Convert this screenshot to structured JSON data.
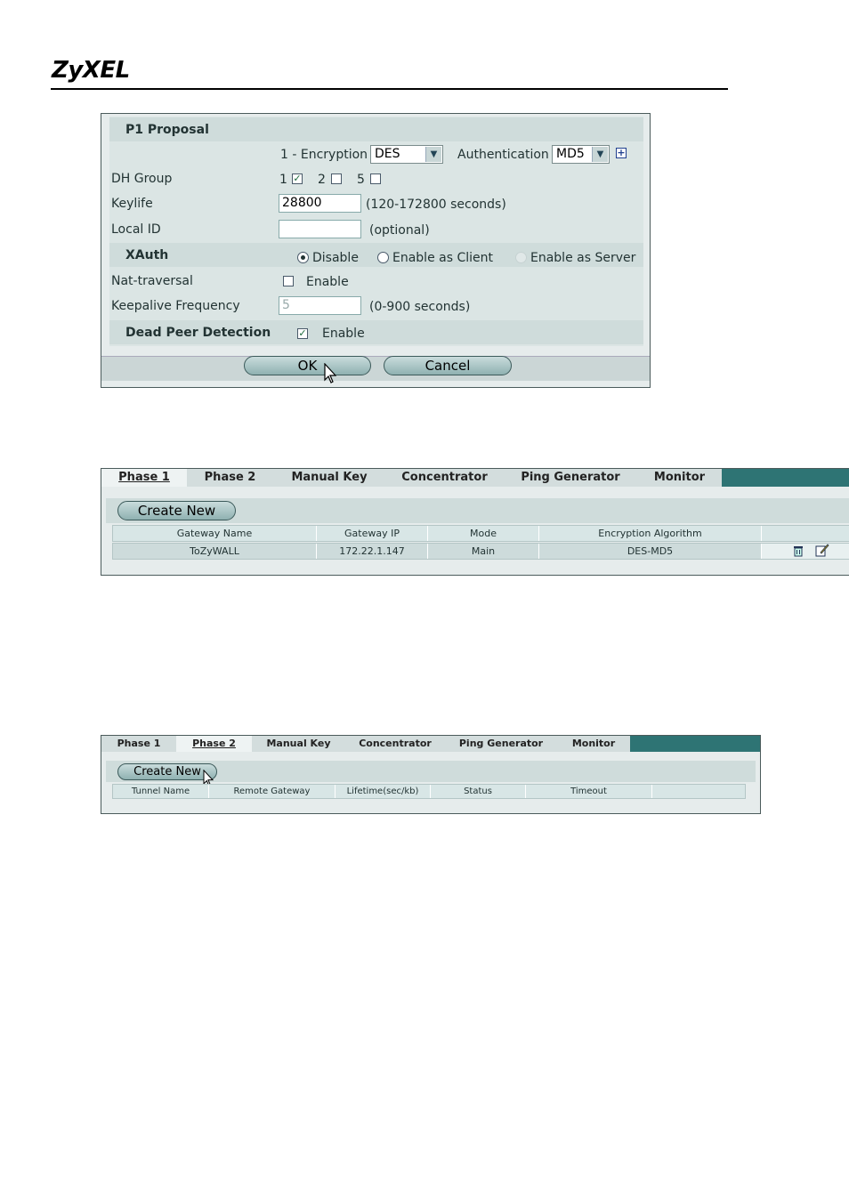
{
  "header": {
    "logo": "ZyXEL"
  },
  "p1": {
    "section_title": "P1 Proposal",
    "encryption_label": "1 - Encryption",
    "encryption_value": "DES",
    "authentication_label": "Authentication",
    "authentication_value": "MD5",
    "dh_group_label": "DH Group",
    "dh_options": [
      {
        "label": "1",
        "checked": true
      },
      {
        "label": "2",
        "checked": false
      },
      {
        "label": "5",
        "checked": false
      }
    ],
    "keylife_label": "Keylife",
    "keylife_value": "28800",
    "keylife_hint": "(120-172800 seconds)",
    "local_id_label": "Local ID",
    "local_id_value": "",
    "local_id_hint": "(optional)",
    "xauth_label": "XAuth",
    "xauth_options": [
      "Disable",
      "Enable as Client",
      "Enable as Server"
    ],
    "xauth_selected": "Disable",
    "nat_label": "Nat-traversal",
    "nat_enable": "Enable",
    "keepalive_label": "Keepalive Frequency",
    "keepalive_value": "5",
    "keepalive_hint": "(0-900 seconds)",
    "dpd_label": "Dead Peer Detection",
    "dpd_enable": "Enable",
    "ok_label": "OK",
    "cancel_label": "Cancel"
  },
  "p2": {
    "tabs": [
      "Phase 1",
      "Phase 2",
      "Manual Key",
      "Concentrator",
      "Ping Generator",
      "Monitor"
    ],
    "active_tab": "Phase 1",
    "create_new": "Create New",
    "columns": [
      "Gateway Name",
      "Gateway IP",
      "Mode",
      "Encryption Algorithm"
    ],
    "rows": [
      [
        "ToZyWALL",
        "172.22.1.147",
        "Main",
        "DES-MD5"
      ]
    ]
  },
  "p3": {
    "tabs": [
      "Phase 1",
      "Phase 2",
      "Manual Key",
      "Concentrator",
      "Ping Generator",
      "Monitor"
    ],
    "active_tab": "Phase 2",
    "create_new": "Create New",
    "columns": [
      "Tunnel Name",
      "Remote Gateway",
      "Lifetime(sec/kb)",
      "Status",
      "Timeout"
    ]
  },
  "colors": {
    "teal": "#2e7474",
    "panel": "#dbe5e4"
  },
  "icons": [
    "add-icon",
    "trash-icon",
    "edit-icon",
    "cursor-icon"
  ]
}
